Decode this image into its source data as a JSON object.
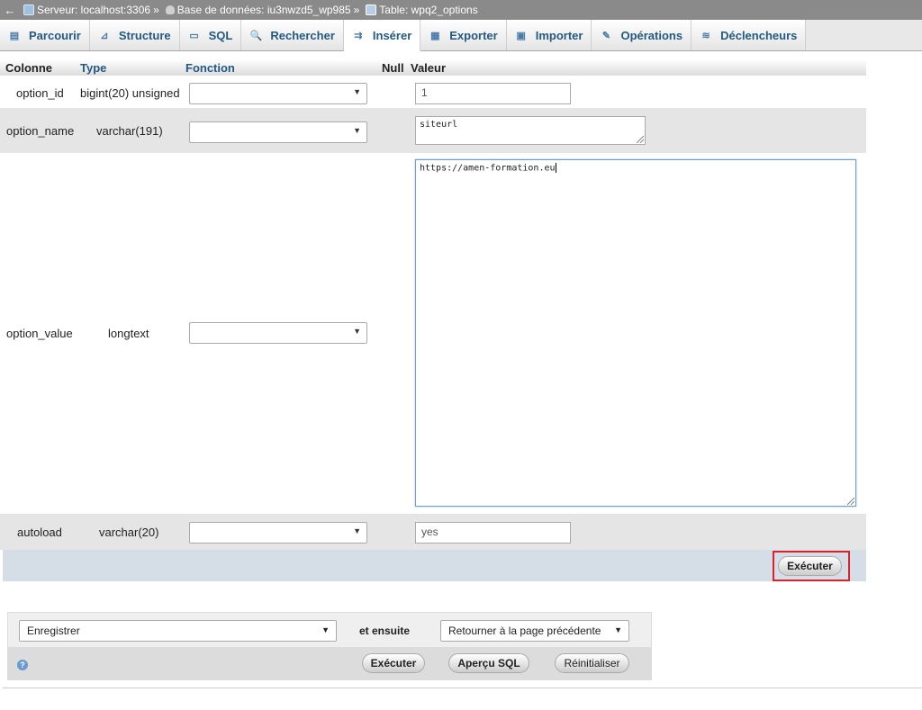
{
  "breadcrumb": {
    "back": "←",
    "server": "Serveur: localhost:3306",
    "separator": "»",
    "database": "Base de données: iu3nwzd5_wp985",
    "table": "Table: wpq2_options"
  },
  "tabs": [
    {
      "label": "Parcourir",
      "icon": "browse-icon",
      "glyph": "▤"
    },
    {
      "label": "Structure",
      "icon": "structure-icon",
      "glyph": "⊿"
    },
    {
      "label": "SQL",
      "icon": "sql-icon",
      "glyph": "▭"
    },
    {
      "label": "Rechercher",
      "icon": "search-icon",
      "glyph": "🔍"
    },
    {
      "label": "Insérer",
      "icon": "insert-icon",
      "glyph": "⇉"
    },
    {
      "label": "Exporter",
      "icon": "export-icon",
      "glyph": "▦"
    },
    {
      "label": "Importer",
      "icon": "import-icon",
      "glyph": "▣"
    },
    {
      "label": "Opérations",
      "icon": "wrench-icon",
      "glyph": "✎"
    },
    {
      "label": "Déclencheurs",
      "icon": "trigger-icon",
      "glyph": "≋"
    }
  ],
  "active_tab": "Insérer",
  "columns_header": {
    "col": "Colonne",
    "type": "Type",
    "func": "Fonction",
    "null": "Null",
    "value": "Valeur"
  },
  "rows": [
    {
      "name": "option_id",
      "type": "bigint(20) unsigned",
      "value": "1"
    },
    {
      "name": "option_name",
      "type": "varchar(191)",
      "value": "siteurl"
    },
    {
      "name": "option_value",
      "type": "longtext",
      "value": "https://amen-formation.eu"
    },
    {
      "name": "autoload",
      "type": "varchar(20)",
      "value": "yes"
    }
  ],
  "execute_label": "Exécuter",
  "bottom": {
    "save_option": "Enregistrer",
    "then_label": "et ensuite",
    "after_option": "Retourner à la page précédente",
    "execute_label": "Exécuter",
    "preview_label": "Aperçu SQL",
    "reset_label": "Réinitialiser",
    "help_glyph": "?"
  },
  "colors": {
    "tab_text": "#235a81",
    "highlight": "#d8232a",
    "breadcrumb_bg": "#8a8a8a"
  }
}
